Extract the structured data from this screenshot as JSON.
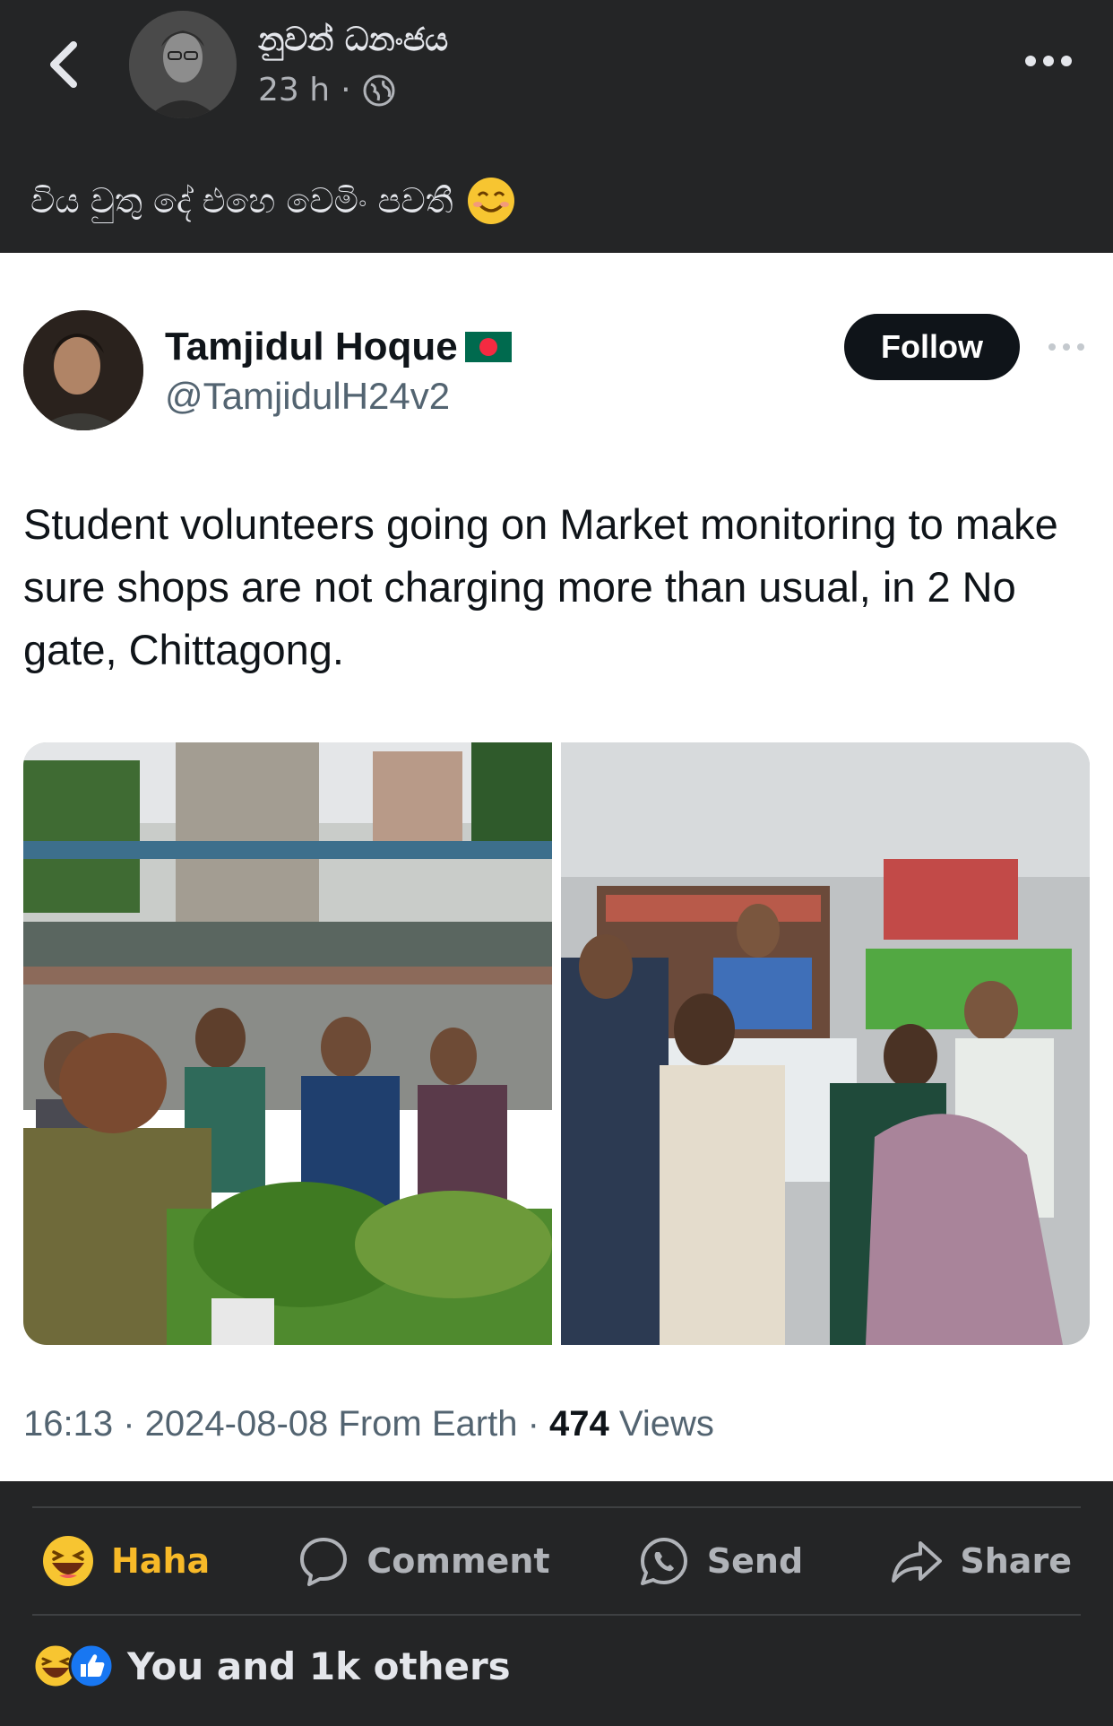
{
  "post": {
    "author": "නුවන් ධනංජය",
    "time": "23 h",
    "separator": "·",
    "caption": "විය වුතු දේ එහෙ වෙමිං පවතී"
  },
  "tweet": {
    "name": "Tamjidul Hoque",
    "handle": "@TamjidulH24v2",
    "follow_label": "Follow",
    "text": "Student volunteers going on Market monitoring to make sure shops are not charging more than usual, in 2 No gate, Chittagong.",
    "footer": {
      "time": "16:13",
      "date": "2024-08-08",
      "source": "From Earth",
      "views_count": "474",
      "views_label": "Views"
    }
  },
  "actions": {
    "haha": "Haha",
    "comment": "Comment",
    "send": "Send",
    "share": "Share"
  },
  "reactions": {
    "summary": "You and 1k others"
  },
  "colors": {
    "background": "#242526",
    "haha": "#f7b928",
    "like": "#1877f2",
    "follow_button": "#0f1419"
  }
}
